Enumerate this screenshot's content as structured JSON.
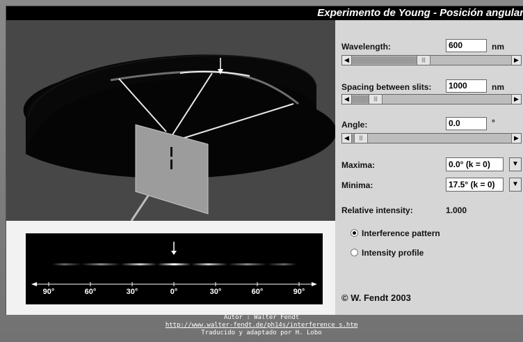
{
  "title": {
    "main": "Experimento de Young",
    "sep": " - ",
    "sub": "Posición angular"
  },
  "controls": {
    "wavelength": {
      "label": "Wavelength:",
      "value": "600",
      "unit": "nm",
      "slider_level": 0.45
    },
    "spacing": {
      "label": "Spacing between slits:",
      "value": "1000",
      "unit": "nm",
      "slider_level": 0.12
    },
    "angle": {
      "label": "Angle:",
      "value": "0.0",
      "unit": "°",
      "slider_level": 0.02
    },
    "maxima": {
      "label": "Maxima:",
      "selected": "0.0°  (k = 0)"
    },
    "minima": {
      "label": "Minima:",
      "selected": "17.5°  (k = 0)"
    },
    "intensity": {
      "label": "Relative intensity:",
      "value": "1.000"
    },
    "display_options": [
      {
        "label": "Interference pattern",
        "selected": true
      },
      {
        "label": "Intensity profile",
        "selected": false
      }
    ],
    "copyright": "© W. Fendt 2003"
  },
  "pattern_scale": [
    "90°",
    "60°",
    "30°",
    "0°",
    "30°",
    "60°",
    "90°"
  ],
  "footer": {
    "author": "Autor : Walter Fendt",
    "url": "http://www.walter-fendt.de/ph14s/interference_s.htm",
    "translator": "Traducido y adaptado por H. Lobo"
  },
  "colors": {
    "background": "#7d7d7d",
    "scene": "#474747",
    "panel": "#d6d6d6",
    "title_bar": "#000000"
  }
}
